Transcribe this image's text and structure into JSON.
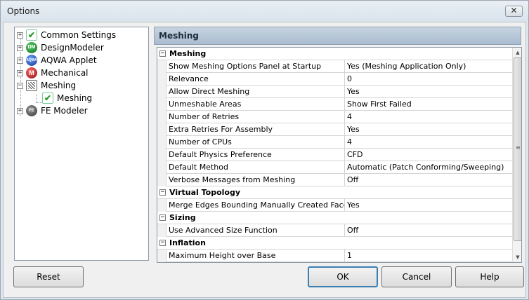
{
  "window": {
    "title": "Options",
    "close_glyph": "✕"
  },
  "tree": {
    "items": [
      {
        "label": "Common Settings",
        "icon": "check-icon",
        "expander": "+"
      },
      {
        "label": "DesignModeler",
        "icon": "designmodeler-icon",
        "icon_text": "DM",
        "expander": "+"
      },
      {
        "label": "AQWA Applet",
        "icon": "aqwa-icon",
        "icon_text": "AQWA",
        "expander": "+"
      },
      {
        "label": "Mechanical",
        "icon": "mechanical-icon",
        "icon_text": "M",
        "expander": "+"
      },
      {
        "label": "Meshing",
        "icon": "meshing-icon",
        "expander": "−"
      },
      {
        "label": "Meshing",
        "icon": "check-icon",
        "child": true
      },
      {
        "label": "FE Modeler",
        "icon": "fe-modeler-icon",
        "icon_text": "FE",
        "expander": "+"
      }
    ]
  },
  "panel": {
    "title": "Meshing"
  },
  "grid": {
    "sections": [
      {
        "label": "Meshing",
        "toggle": "−",
        "props": [
          {
            "name": "Show Meshing Options Panel at Startup",
            "value": "Yes (Meshing Application Only)"
          },
          {
            "name": "Relevance",
            "value": "0"
          },
          {
            "name": "Allow Direct Meshing",
            "value": "Yes"
          },
          {
            "name": "Unmeshable Areas",
            "value": "Show First Failed"
          },
          {
            "name": "Number of Retries",
            "value": "4"
          },
          {
            "name": "Extra Retries For Assembly",
            "value": "Yes"
          },
          {
            "name": "Number of CPUs",
            "value": "4"
          },
          {
            "name": "Default Physics Preference",
            "value": "CFD"
          },
          {
            "name": "Default Method",
            "value": "Automatic (Patch Conforming/Sweeping)"
          },
          {
            "name": "Verbose Messages from Meshing",
            "value": "Off"
          }
        ]
      },
      {
        "label": "Virtual Topology",
        "toggle": "−",
        "props": [
          {
            "name": "Merge Edges Bounding Manually Created Faces",
            "value": "Yes"
          }
        ]
      },
      {
        "label": "Sizing",
        "toggle": "−",
        "props": [
          {
            "name": "Use Advanced Size Function",
            "value": "Off"
          }
        ]
      },
      {
        "label": "Inflation",
        "toggle": "−",
        "props": [
          {
            "name": "Maximum Height over Base",
            "value": "1"
          }
        ]
      }
    ]
  },
  "scrollbar": {
    "up_glyph": "▲",
    "down_glyph": "▼",
    "grip_glyph": "≡"
  },
  "buttons": {
    "reset": "Reset",
    "ok": "OK",
    "cancel": "Cancel",
    "help": "Help"
  }
}
